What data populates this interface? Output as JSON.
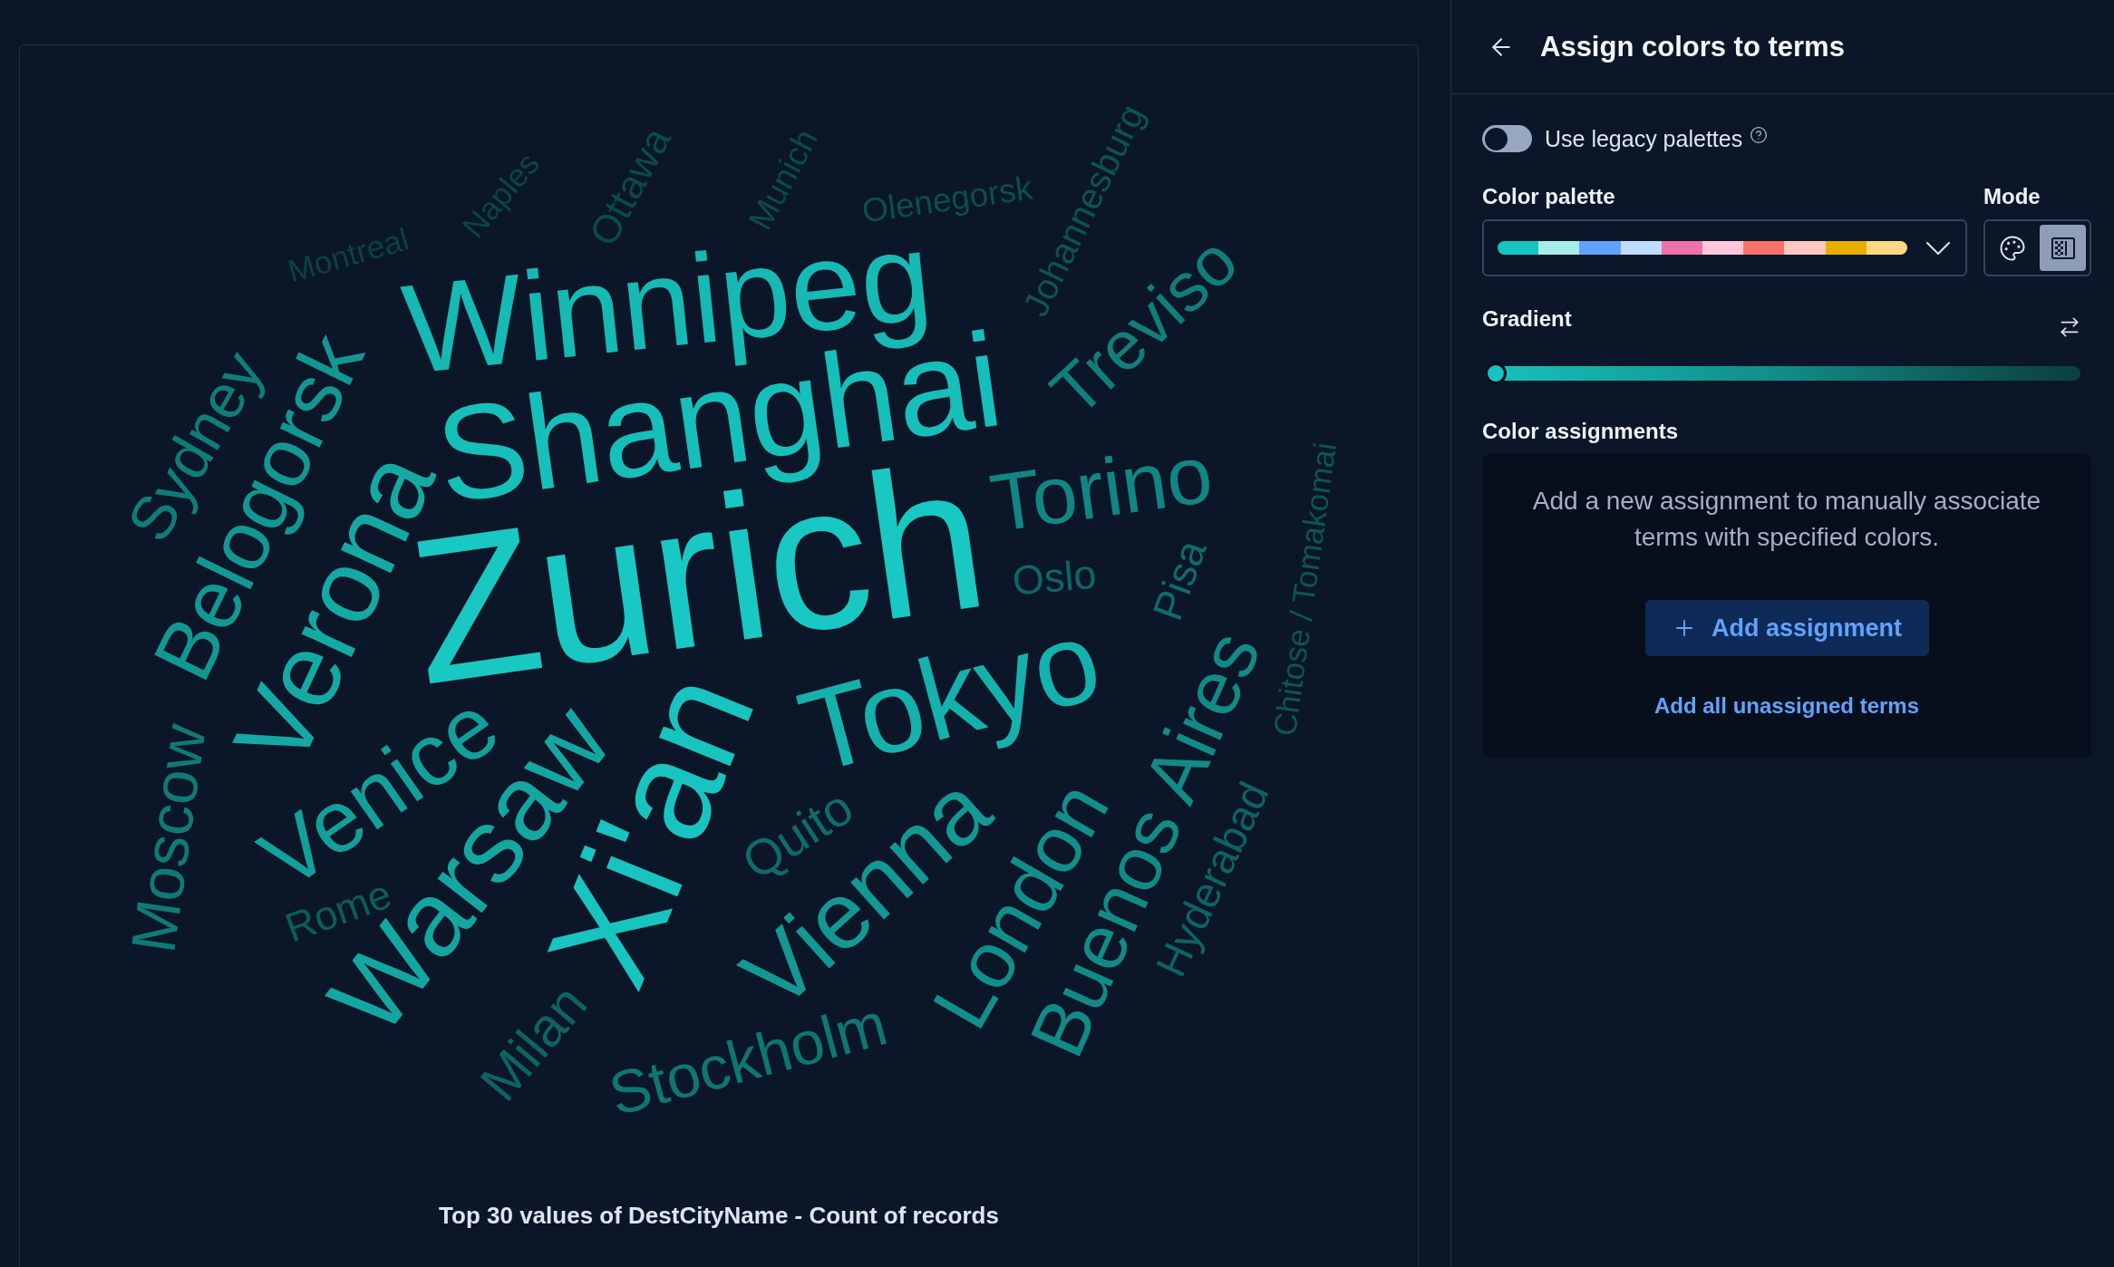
{
  "chart_panel": {
    "word_cloud": {
      "words": [
        {
          "text": "Zurich",
          "color": "#19c8c2"
        },
        {
          "text": "Xi'an",
          "color": "#18c4bf"
        },
        {
          "text": "Shanghai",
          "color": "#17bfba"
        },
        {
          "text": "Winnipeg",
          "color": "#16b9b4"
        },
        {
          "text": "Tokyo",
          "color": "#15b1ac"
        },
        {
          "text": "Verona",
          "color": "#15a9a4"
        },
        {
          "text": "Warsaw",
          "color": "#14a6a1"
        },
        {
          "text": "Venice",
          "color": "#13a09b"
        },
        {
          "text": "Vienna",
          "color": "#139893"
        },
        {
          "text": "Belogorsk",
          "color": "#139792"
        },
        {
          "text": "London",
          "color": "#128f8a"
        },
        {
          "text": "Buenos Aires",
          "color": "#128a86"
        },
        {
          "text": "Torino",
          "color": "#118682"
        },
        {
          "text": "Treviso",
          "color": "#107f7b"
        },
        {
          "text": "Sydney",
          "color": "#0f7d79"
        },
        {
          "text": "Moscow",
          "color": "#0f7a76"
        },
        {
          "text": "Stockholm",
          "color": "#0f7672"
        },
        {
          "text": "Quito",
          "color": "#0e6c69"
        },
        {
          "text": "Pisa",
          "color": "#0e6c69"
        },
        {
          "text": "Oslo",
          "color": "#0d6764"
        },
        {
          "text": "Milan",
          "color": "#0d6461"
        },
        {
          "text": "Hyderabad",
          "color": "#0d6461"
        },
        {
          "text": "Rome",
          "color": "#0c5e5b"
        },
        {
          "text": "Chitose / Tomakomai",
          "color": "#0b5654"
        },
        {
          "text": "Johannesburg",
          "color": "#0b5452"
        },
        {
          "text": "Olenegorsk",
          "color": "#0a4f4d"
        },
        {
          "text": "Munich",
          "color": "#0a4b49"
        },
        {
          "text": "Ottawa",
          "color": "#0a4b49"
        },
        {
          "text": "Naples",
          "color": "#094644"
        },
        {
          "text": "Montreal",
          "color": "#094341"
        }
      ]
    },
    "caption": "Top 30 values of DestCityName - Count of records"
  },
  "flyout": {
    "title": "Assign colors to terms",
    "legacy_toggle": {
      "label": "Use legacy palettes",
      "on": false
    },
    "palette": {
      "label": "Color palette",
      "swatches": [
        {
          "color": "#16c5c0"
        },
        {
          "color": "#a6ede9"
        },
        {
          "color": "#61a2ff"
        },
        {
          "color": "#bfdbff"
        },
        {
          "color": "#ee72a6"
        },
        {
          "color": "#ffc7db"
        },
        {
          "color": "#f6726a"
        },
        {
          "color": "#ffc9c2"
        },
        {
          "color": "#eaae01"
        },
        {
          "color": "#fcd883"
        }
      ]
    },
    "mode": {
      "label": "Mode",
      "options": [
        {
          "kind": "categorical",
          "selected": false
        },
        {
          "kind": "gradient",
          "selected": true
        }
      ]
    },
    "gradient": {
      "label": "Gradient",
      "level": 0
    },
    "assignments": {
      "label": "Color assignments",
      "empty_message": "Add a new assignment to manually associate terms with specified colors.",
      "add_button": "Add assignment",
      "add_all_link": "Add all unassigned terms"
    }
  }
}
